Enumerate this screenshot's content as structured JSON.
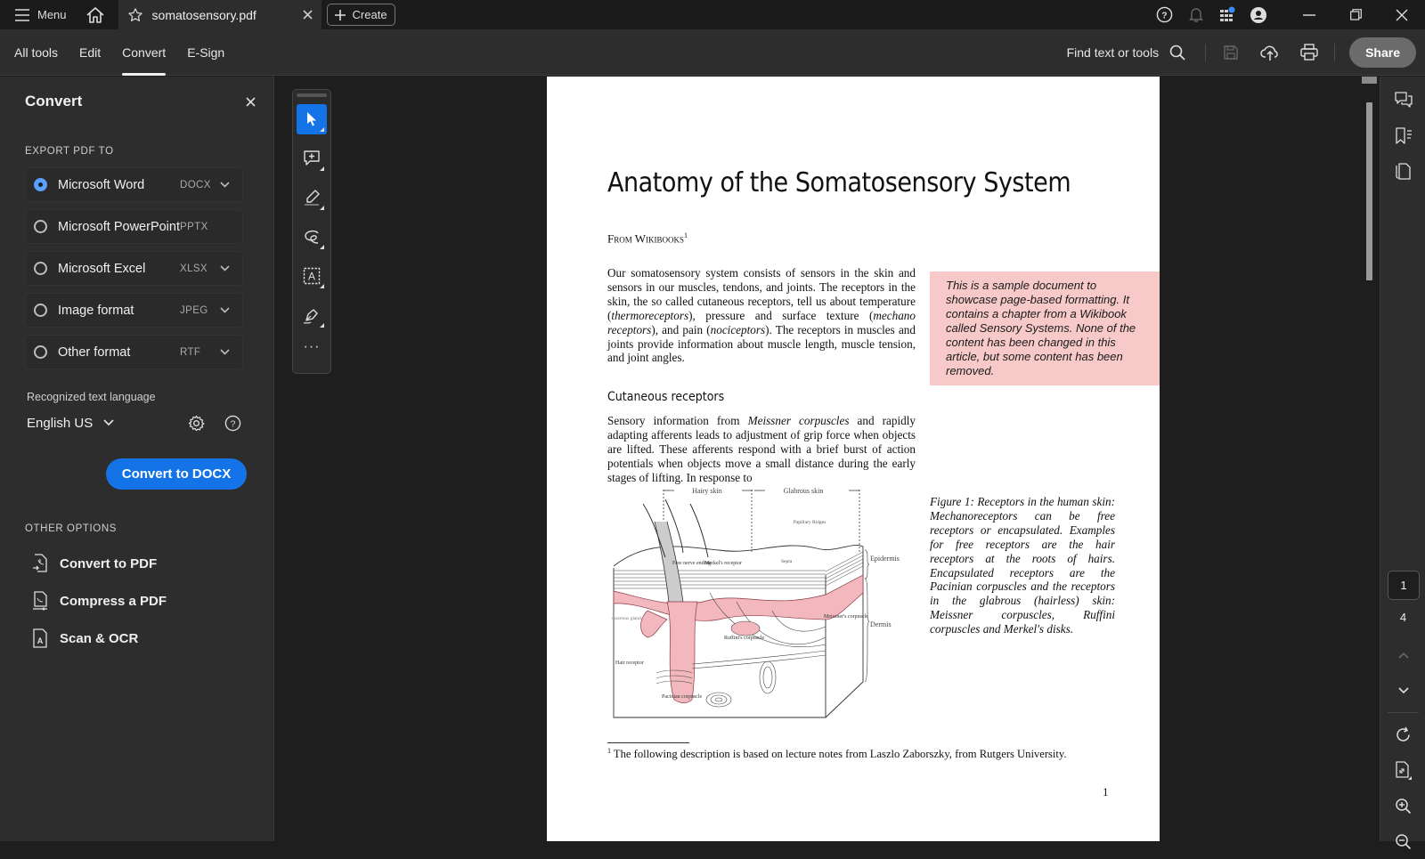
{
  "titlebar": {
    "menu_label": "Menu",
    "tab_title": "somatosensory.pdf",
    "create_label": "Create",
    "notification_dot_color": "#3b8cf5"
  },
  "toolbar": {
    "tabs": [
      {
        "label": "All tools",
        "active": false
      },
      {
        "label": "Edit",
        "active": false
      },
      {
        "label": "Convert",
        "active": true
      },
      {
        "label": "E-Sign",
        "active": false
      }
    ],
    "find_label": "Find text or tools",
    "share_label": "Share"
  },
  "left_panel": {
    "title": "Convert",
    "export_label": "EXPORT PDF TO",
    "formats": [
      {
        "name": "Microsoft Word",
        "ext": "DOCX",
        "selected": true,
        "has_dropdown": true
      },
      {
        "name": "Microsoft PowerPoint",
        "ext": "PPTX",
        "selected": false,
        "has_dropdown": false
      },
      {
        "name": "Microsoft Excel",
        "ext": "XLSX",
        "selected": false,
        "has_dropdown": true
      },
      {
        "name": "Image format",
        "ext": "JPEG",
        "selected": false,
        "has_dropdown": true
      },
      {
        "name": "Other format",
        "ext": "RTF",
        "selected": false,
        "has_dropdown": true
      }
    ],
    "language_label": "Recognized text language",
    "language_value": "English US",
    "convert_button": "Convert to DOCX",
    "accent_color": "#1473e6",
    "other_label": "OTHER OPTIONS",
    "other_options": [
      {
        "label": "Convert to PDF",
        "icon": "convert-to-pdf-icon"
      },
      {
        "label": "Compress a PDF",
        "icon": "compress-pdf-icon"
      },
      {
        "label": "Scan & OCR",
        "icon": "scan-ocr-icon"
      }
    ]
  },
  "quick_tools": [
    "select-tool",
    "add-comment-tool",
    "highlight-tool",
    "draw-tool",
    "text-recognition-tool",
    "sign-tool",
    "more-tools"
  ],
  "document": {
    "title": "Anatomy of the Somatosensory System",
    "from": "From Wikibooks",
    "from_footnote_mark": "1",
    "para1_parts": [
      {
        "t": "Our somatosensory system consists of sensors in the skin and sensors in our muscles, tendons, and joints. The receptors in the skin, the so called cutaneous receptors, tell us about temperature (",
        "i": false
      },
      {
        "t": "thermoreceptors",
        "i": true
      },
      {
        "t": "), pressure and surface texture (",
        "i": false
      },
      {
        "t": "mechano receptors",
        "i": true
      },
      {
        "t": "), and pain (",
        "i": false
      },
      {
        "t": "nociceptors",
        "i": true
      },
      {
        "t": "). The receptors in muscles and joints provide information about muscle length, muscle tension, and joint angles.",
        "i": false
      }
    ],
    "note": "This is a sample document to showcase page-based formatting. It contains a chapter from a Wikibook called Sensory Systems. None of the content has been changed in this article, but some content has been removed.",
    "heading": "Cutaneous receptors",
    "para2_parts": [
      {
        "t": "Sensory information from ",
        "i": false
      },
      {
        "t": "Meissner corpuscles",
        "i": true
      },
      {
        "t": " and rapidly adapting afferents leads to adjustment of grip force when objects are lifted. These afferents respond with a brief burst of action potentials when objects move a small distance during the early stages of lifting. In response to",
        "i": false
      }
    ],
    "figure_labels": {
      "hairy": "Hairy skin",
      "glabrous": "Glabrous skin",
      "papillary": "Papillary Ridges",
      "septa": "Septa",
      "free_nerve": "Free nerve ending",
      "merkel": "Merkel's receptor",
      "epidermis": "Epidermis",
      "dermis": "Dermis",
      "sebaceous": "Sebaceous gland",
      "meissner": "Meissner's corpuscle",
      "ruffini": "Ruffini's corpuscle",
      "hair_receptor": "Hair receptor",
      "pacinian": "Pacinian corpuscle"
    },
    "caption": "Figure 1:  Receptors in the human skin: Mechanoreceptors can be free receptors or encapsulated. Examples for free receptors are the hair receptors at the roots of hairs. Encapsulated receptors are the Pacinian corpuscles and the receptors in the glabrous (hairless) skin: Meissner corpuscles, Ruffini corpuscles and Merkel's disks.",
    "footnote_mark": "1",
    "footnote": " The following description is based on lecture notes from Laszlo Zaborszky, from Rutgers University.",
    "page_number": "1",
    "note_bg": "#f8c9c9",
    "skin_pink": "#f2b8bd"
  },
  "page_nav": {
    "current_page": "1",
    "total_pages": "4"
  }
}
